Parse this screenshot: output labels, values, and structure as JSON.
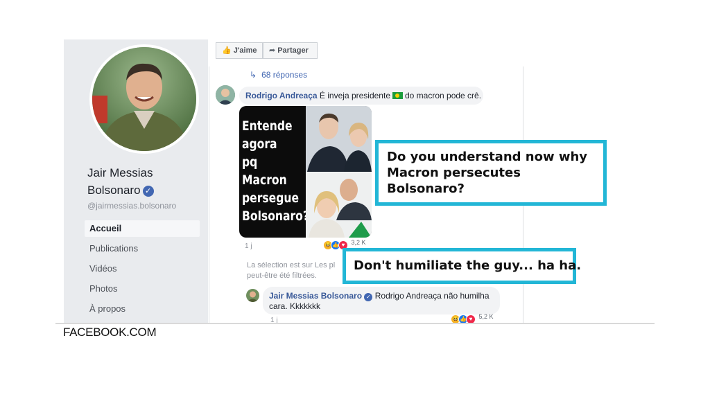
{
  "profile": {
    "name_line1": "Jair Messias",
    "name_line2": "Bolsonaro",
    "verified_mark": "✓",
    "handle": "@jairmessias.bolsonaro"
  },
  "nav": {
    "items": [
      {
        "label": "Accueil",
        "active": true
      },
      {
        "label": "Publications"
      },
      {
        "label": "Vidéos"
      },
      {
        "label": "Photos"
      },
      {
        "label": "À propos"
      }
    ]
  },
  "actions": {
    "like_label": "J'aime",
    "share_label": "Partager",
    "like_icon": "thumbs-up-icon",
    "share_icon": "share-arrow-icon"
  },
  "thread": {
    "replies_label": "68 réponses",
    "comment1": {
      "author": "Rodrigo Andreaça",
      "text_before_flag": "É inveja presidente",
      "text_after_flag": "do macron pode crê.",
      "meme_text": [
        "Entende",
        "agora",
        "pq Macron",
        "persegue",
        "Bolsonaro?"
      ],
      "reaction_count": "3,2 K",
      "time": "1 j"
    },
    "filter_note_line1": "La sélection est sur Les pl",
    "filter_note_line2": "peut-être été filtrées.",
    "reply": {
      "author": "Jair Messias Bolsonaro",
      "text_line1": "Rodrigo Andreaça não humilha",
      "text_line2": "cara. Kkkkkkk",
      "reaction_count": "5,2 K",
      "time": "1 j"
    }
  },
  "captions": {
    "caption1_lines": [
      "Do you understand now why",
      "Macron persecutes",
      "Bolsonaro?"
    ],
    "caption2": "Don't humiliate the guy... ha ha."
  },
  "source": "FACEBOOK.COM",
  "colors": {
    "caption_border": "#22b6d6",
    "fb_link": "#385898",
    "sidebar_bg": "#e9ebee"
  }
}
